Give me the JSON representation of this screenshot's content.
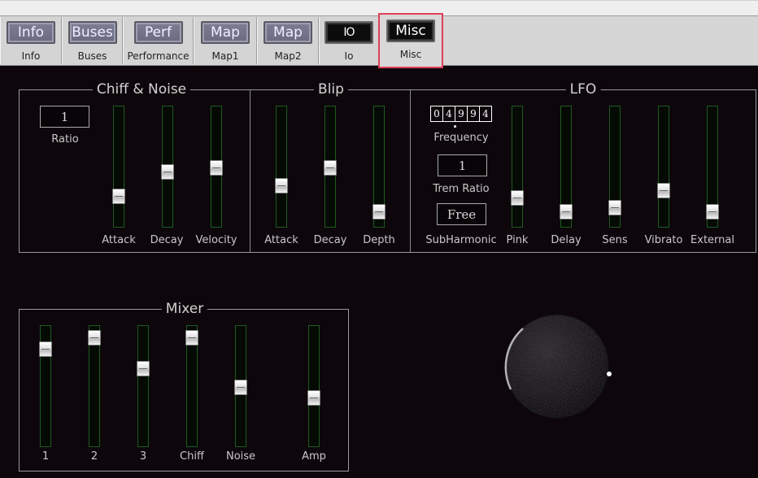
{
  "tabs": [
    {
      "button": "Info",
      "label": "Info"
    },
    {
      "button": "Buses",
      "label": "Buses"
    },
    {
      "button": "Perf",
      "label": "Performance"
    },
    {
      "button": "Map",
      "label": "Map1"
    },
    {
      "button": "Map",
      "label": "Map2"
    },
    {
      "button": "IO",
      "label": "Io"
    },
    {
      "button": "Misc",
      "label": "Misc"
    }
  ],
  "selected_tab": "Misc",
  "chiff_noise": {
    "title": "Chiff & Noise",
    "ratio_value": "1",
    "ratio_label": "Ratio",
    "sliders": [
      {
        "label": "Attack",
        "level": 0.22
      },
      {
        "label": "Decay",
        "level": 0.45
      },
      {
        "label": "Velocity",
        "level": 0.49
      }
    ]
  },
  "blip": {
    "title": "Blip",
    "sliders": [
      {
        "label": "Attack",
        "level": 0.32
      },
      {
        "label": "Decay",
        "level": 0.49
      },
      {
        "label": "Depth",
        "level": 0.07
      }
    ]
  },
  "lfo": {
    "title": "LFO",
    "frequency_digits": [
      "0",
      "4",
      "9",
      "9",
      "4"
    ],
    "frequency_label": "Frequency",
    "trem_ratio_value": "1",
    "trem_ratio_label": "Trem Ratio",
    "subharmonic_value": "Free",
    "subharmonic_label": "SubHarmonic",
    "sliders": [
      {
        "label": "Pink",
        "level": 0.2
      },
      {
        "label": "Delay",
        "level": 0.07
      },
      {
        "label": "Sens",
        "level": 0.11
      },
      {
        "label": "Vibrato",
        "level": 0.27
      },
      {
        "label": "External",
        "level": 0.07
      }
    ]
  },
  "mixer": {
    "title": "Mixer",
    "sliders": [
      {
        "label": "1",
        "level": 0.85
      },
      {
        "label": "2",
        "level": 0.96
      },
      {
        "label": "3",
        "level": 0.67
      },
      {
        "label": "Chiff",
        "level": 0.96
      },
      {
        "label": "Noise",
        "level": 0.49
      },
      {
        "label": "Amp",
        "level": 0.39
      }
    ]
  },
  "colors": {
    "background": "#0d070c",
    "slider_border": "#1f5a1f",
    "selected_tab_outline": "#e0405a"
  }
}
